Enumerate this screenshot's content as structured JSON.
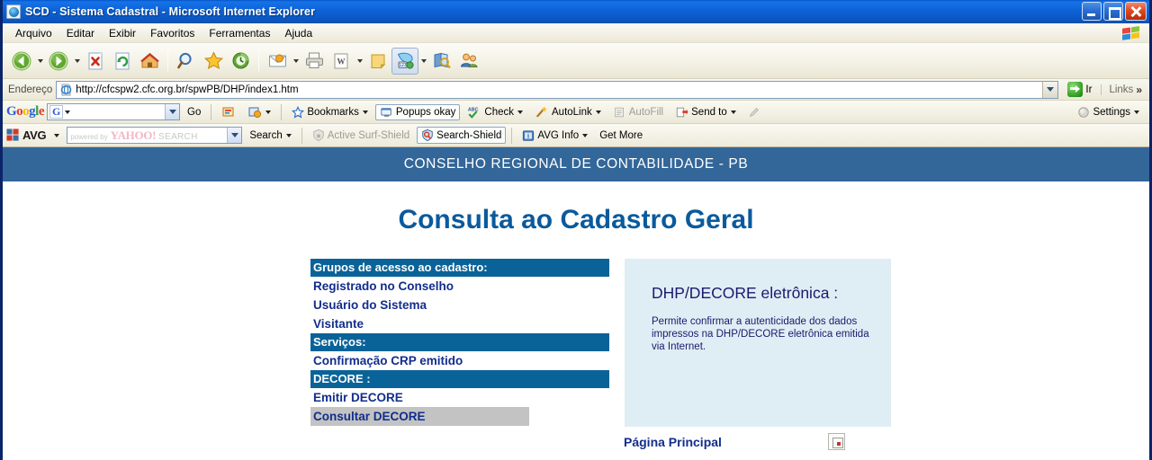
{
  "window": {
    "title": "SCD - Sistema Cadastral - Microsoft Internet Explorer",
    "app_icon": "ie-document-icon",
    "controls": {
      "minimize": "minimize-icon",
      "restore": "restore-icon",
      "close": "close-icon"
    }
  },
  "menubar": {
    "items": [
      {
        "label": "Arquivo"
      },
      {
        "label": "Editar"
      },
      {
        "label": "Exibir"
      },
      {
        "label": "Favoritos"
      },
      {
        "label": "Ferramentas"
      },
      {
        "label": "Ajuda"
      }
    ],
    "brand_icon": "windows-flag-icon"
  },
  "toolbar": {
    "buttons": [
      {
        "name": "back-button",
        "icon": "arrow-left-icon",
        "dropdown": true
      },
      {
        "name": "forward-button",
        "icon": "arrow-right-icon",
        "dropdown": true
      },
      {
        "name": "stop-button",
        "icon": "stop-icon",
        "dropdown": false
      },
      {
        "name": "refresh-button",
        "icon": "refresh-icon",
        "dropdown": false
      },
      {
        "name": "home-button",
        "icon": "home-icon",
        "dropdown": false
      },
      {
        "name": "search-button",
        "icon": "magnifier-icon",
        "dropdown": false
      },
      {
        "name": "favorites-button",
        "icon": "star-icon",
        "dropdown": false
      },
      {
        "name": "history-button",
        "icon": "history-clock-icon",
        "dropdown": false
      },
      {
        "name": "mail-button",
        "icon": "envelope-icon",
        "dropdown": true
      },
      {
        "name": "print-button",
        "icon": "printer-icon",
        "dropdown": false
      },
      {
        "name": "edit-button",
        "icon": "word-document-icon",
        "dropdown": true
      },
      {
        "name": "notes-button",
        "icon": "sticky-note-icon",
        "dropdown": false
      },
      {
        "name": "messenger-button",
        "icon": "messenger-icon",
        "dropdown": true
      },
      {
        "name": "research-button",
        "icon": "research-icon",
        "dropdown": false
      },
      {
        "name": "discuss-button",
        "icon": "discuss-people-icon",
        "dropdown": false
      }
    ]
  },
  "address_bar": {
    "label": "Endereço",
    "icon": "ie-page-icon",
    "url": "http://cfcspw2.cfc.org.br/spwPB/DHP/index1.htm",
    "placeholder": "",
    "dropdown_icon": "chevron-down-icon",
    "go_label": "Ir",
    "go_icon": "go-arrow-icon",
    "links_label": "Links",
    "links_chevron": "»"
  },
  "google_toolbar": {
    "logo": {
      "g1": "G",
      "o1": "o",
      "o2": "o",
      "g2": "g",
      "l": "l",
      "e": "e"
    },
    "search_value": "",
    "search_prefix": "G",
    "items": [
      {
        "name": "go-link",
        "label": "Go",
        "icon": null,
        "caret": false,
        "disabled": false,
        "boxed": false
      },
      {
        "name": "highlight-button",
        "label": "",
        "icon": "highlight-icon",
        "caret": false,
        "disabled": false,
        "boxed": false
      },
      {
        "name": "options-button",
        "label": "",
        "icon": "options-icon",
        "caret": true,
        "disabled": false,
        "boxed": false
      },
      {
        "name": "bookmarks-button",
        "label": "Bookmarks",
        "icon": "star-icon",
        "caret": true,
        "disabled": false,
        "boxed": false
      },
      {
        "name": "popups-button",
        "label": "Popups okay",
        "icon": "popup-blocker-icon",
        "caret": false,
        "disabled": false,
        "boxed": true
      },
      {
        "name": "check-button",
        "label": "Check",
        "icon": "spellcheck-abc-icon",
        "caret": true,
        "disabled": false,
        "boxed": false
      },
      {
        "name": "autolink-button",
        "label": "AutoLink",
        "icon": "autolink-wand-icon",
        "caret": true,
        "disabled": false,
        "boxed": false
      },
      {
        "name": "autofill-button",
        "label": "AutoFill",
        "icon": "autofill-form-icon",
        "caret": false,
        "disabled": true,
        "boxed": false
      },
      {
        "name": "sendto-button",
        "label": "Send to",
        "icon": "sendto-icon",
        "caret": true,
        "disabled": false,
        "boxed": false
      },
      {
        "name": "pencil-button",
        "label": "",
        "icon": "pencil-icon",
        "caret": false,
        "disabled": true,
        "boxed": false
      }
    ],
    "settings_label": "Settings",
    "settings_icon": "settings-circle-icon"
  },
  "avg_toolbar": {
    "brand": "AVG",
    "brand_icon": "avg-squares-icon",
    "search_value": "",
    "search_watermark": {
      "powered": "powered by",
      "yahoo": "YAHOO!",
      "search": "SEARCH"
    },
    "items": [
      {
        "name": "search-button",
        "label": "Search",
        "icon": null,
        "caret": true,
        "disabled": false,
        "boxed": false
      },
      {
        "name": "active-surf-shield",
        "label": "Active  Surf-Shield",
        "icon": "shield-lock-icon",
        "caret": false,
        "disabled": true,
        "boxed": false
      },
      {
        "name": "search-shield",
        "label": "Search-Shield",
        "icon": "shield-magnifier-icon",
        "caret": false,
        "disabled": false,
        "boxed": true
      },
      {
        "name": "avg-info",
        "label": "AVG Info",
        "icon": "avg-info-icon",
        "caret": true,
        "disabled": false,
        "boxed": false
      },
      {
        "name": "get-more",
        "label": "Get More",
        "icon": null,
        "caret": false,
        "disabled": false,
        "boxed": false
      }
    ]
  },
  "page": {
    "banner_text": "CONSELHO REGIONAL DE CONTABILIDADE - PB",
    "banner_color": "#336699",
    "title": "Consulta ao Cadastro Geral",
    "title_color": "#0a5a9c",
    "menu": {
      "section_color": "#0a6398",
      "link_color": "#122d8c",
      "selected_bg": "#c3c3c3",
      "entries": [
        {
          "type": "header",
          "label": "Grupos de acesso ao cadastro:",
          "name": "menu-header-grupos"
        },
        {
          "type": "link",
          "label": "Registrado no Conselho",
          "name": "menu-link-registrado-no-conselho",
          "selected": false
        },
        {
          "type": "link",
          "label": "Usuário do Sistema",
          "name": "menu-link-usuario-do-sistema",
          "selected": false
        },
        {
          "type": "link",
          "label": "Visitante",
          "name": "menu-link-visitante",
          "selected": false
        },
        {
          "type": "header",
          "label": "Serviços:",
          "name": "menu-header-servicos"
        },
        {
          "type": "link",
          "label": "Confirmação CRP emitido",
          "name": "menu-link-confirmacao-crp-emitido",
          "selected": false
        },
        {
          "type": "header",
          "label": "DECORE :",
          "name": "menu-header-decore"
        },
        {
          "type": "link",
          "label": "Emitir DECORE",
          "name": "menu-link-emitir-decore",
          "selected": false
        },
        {
          "type": "link",
          "label": "Consultar DECORE",
          "name": "menu-link-consultar-decore",
          "selected": true
        }
      ]
    },
    "info_box": {
      "bg_color": "#dfeef4",
      "title": "DHP/DECORE eletrônica :",
      "text": "Permite confirmar a autenticidade dos dados impressos na DHP/DECORE eletrônica emitida via Internet."
    },
    "footer": {
      "home_link": "Página Principal",
      "broken_image_icon": "broken-image-icon"
    }
  }
}
